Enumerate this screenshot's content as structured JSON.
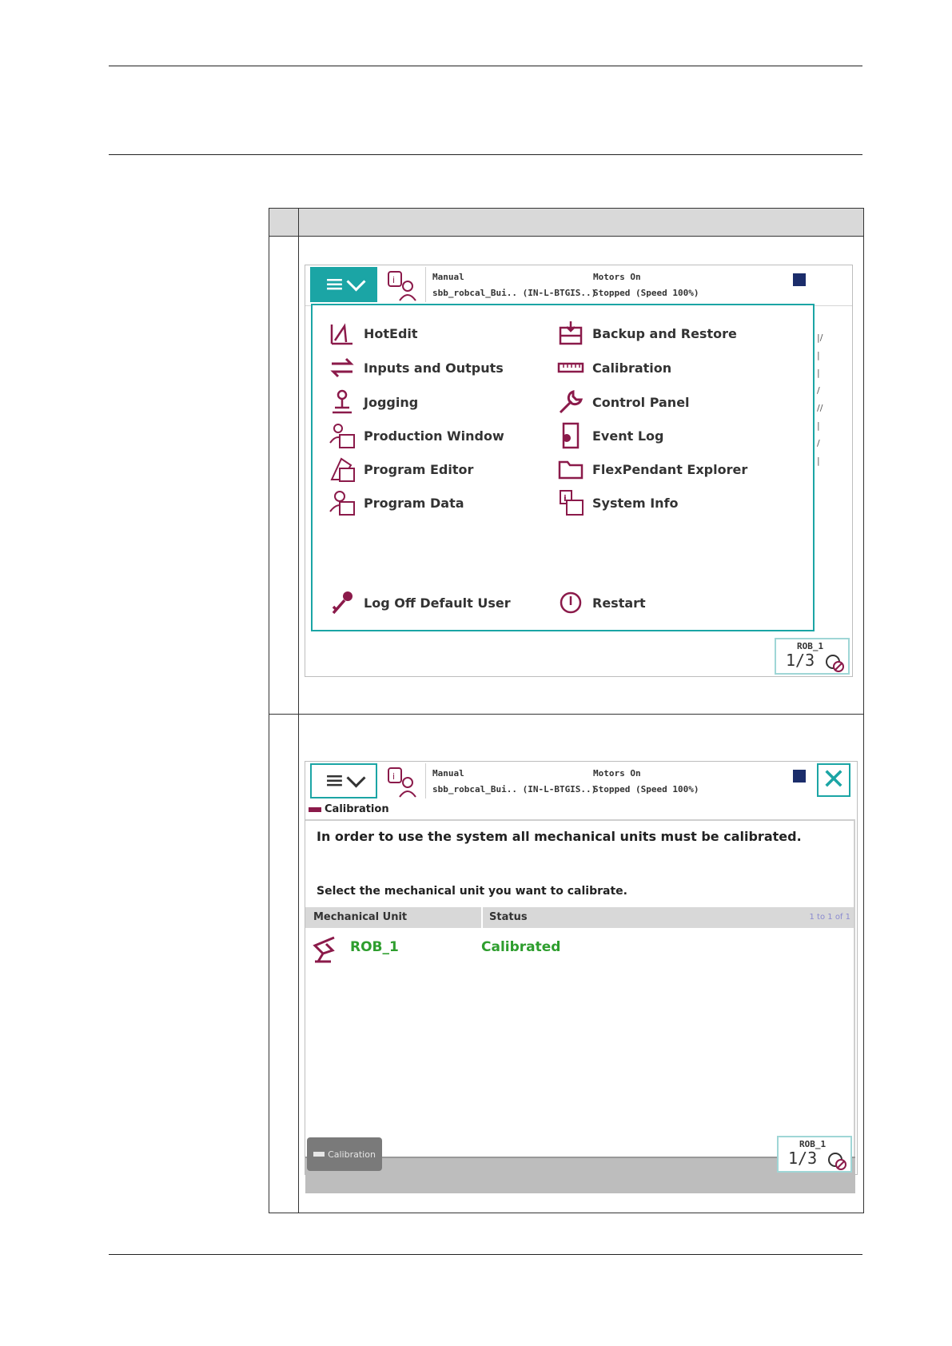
{
  "screen1": {
    "status": {
      "mode": "Manual",
      "system": "sbb_robcal_Bui.. (IN-L-BTGIS..)",
      "motors": "Motors On",
      "state": "Stopped (Speed 100%)"
    },
    "menu_left": [
      "HotEdit",
      "Inputs and Outputs",
      "Jogging",
      "Production Window",
      "Program Editor",
      "Program Data"
    ],
    "menu_right": [
      "Backup and Restore",
      "Calibration",
      "Control Panel",
      "Event Log",
      "FlexPendant Explorer",
      "System Info"
    ],
    "log_off": "Log Off Default User",
    "restart": "Restart",
    "rob": {
      "label": "ROB_1",
      "fraction": "1/3"
    }
  },
  "screen2": {
    "status": {
      "mode": "Manual",
      "system": "sbb_robcal_Bui.. (IN-L-BTGIS..)",
      "motors": "Motors On",
      "state": "Stopped (Speed 100%)"
    },
    "title": "Calibration",
    "intro": "In order to use the system all mechanical units must be calibrated.",
    "select": "Select the mechanical unit you want to calibrate.",
    "columns": [
      "Mechanical Unit",
      "Status"
    ],
    "paging": "1 to 1 of 1",
    "rows": [
      {
        "unit": "ROB_1",
        "status": "Calibrated"
      }
    ],
    "task_button": "Calibration",
    "rob": {
      "label": "ROB_1",
      "fraction": "1/3"
    }
  },
  "colors": {
    "accent": "#1ba5a5",
    "icon": "#8b1a4a",
    "ok": "#2e9e2e"
  }
}
